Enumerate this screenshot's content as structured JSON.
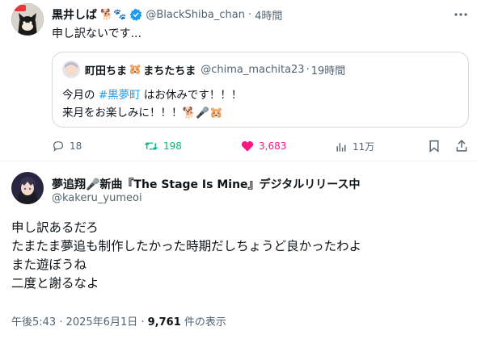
{
  "colors": {
    "text": "#0f1419",
    "muted": "#536471",
    "link": "#1d9bf0",
    "retweet": "#00ba7c",
    "like": "#f91880",
    "border": "#cfd9de"
  },
  "tweet": {
    "display_name": "黒井しば",
    "name_emojis": "🐕🐾",
    "handle": "@BlackShiba_chan",
    "separator": "·",
    "time": "4時間",
    "text": "申し訳ないです...",
    "quote": {
      "display_name": "町田ちま",
      "name_emoji_1": "🐹",
      "display_name_2": "まちたちま",
      "handle": "@chima_machita23",
      "separator": "·",
      "time": "19時間",
      "line1_pre": "今月の ",
      "hashtag": "#黒夢町",
      "line1_post": " はお休みです！！！",
      "line2": "来月をお楽しみに！！！🐕🎤🐹"
    },
    "actions": {
      "replies": "18",
      "retweets": "198",
      "likes": "3,683",
      "views": "11万"
    }
  },
  "reply": {
    "display_name": "夢追翔🎤新曲『The Stage Is Mine』デジタルリリース中",
    "handle": "@kakeru_yumeoi",
    "lines": [
      "申し訳あるだろ",
      "たまたま夢追も制作したかった時期だしちょうど良かったわよ",
      "また遊ぼうね",
      "二度と謝るなよ"
    ],
    "timestamp": "午後5:43 · 2025年6月1日 · ",
    "views_count": "9,761",
    "views_label": " 件の表示"
  },
  "icons": {
    "more": "more-icon",
    "reply": "reply-icon",
    "retweet": "retweet-icon",
    "like": "heart-icon",
    "views": "views-icon",
    "bookmark": "bookmark-icon",
    "share": "share-icon",
    "verified": "verified-badge-icon"
  }
}
